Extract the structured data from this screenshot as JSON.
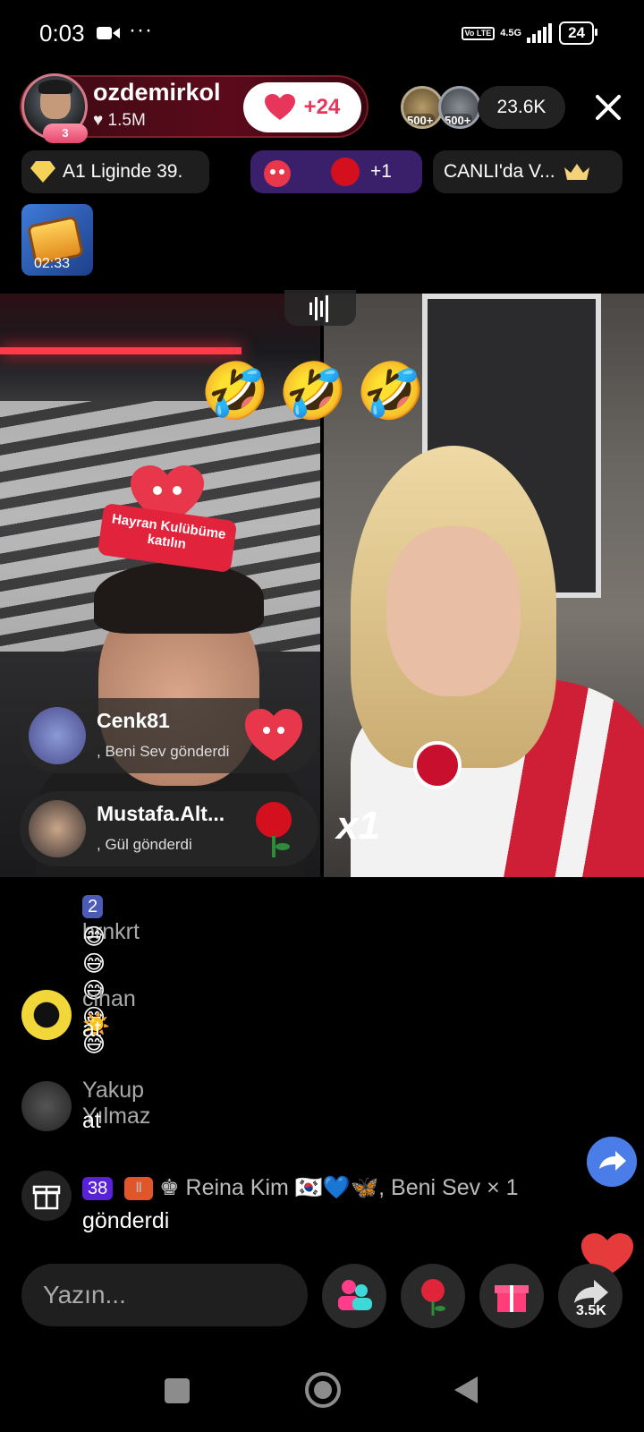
{
  "status_bar": {
    "time": "0:03",
    "dots": "···",
    "network_volte": "Vo LTE",
    "network_type": "4.5G",
    "battery": "24"
  },
  "host": {
    "name": "ozdemirkol",
    "likes": "♥ 1.5M",
    "rank": "3",
    "like_button": "+24"
  },
  "viewers": {
    "badge_1": "500+",
    "badge_2": "500+",
    "count": "23.6K"
  },
  "pills": {
    "league": "A1 Liginde 39.",
    "gift_plus": "+1",
    "canli": "CANLI'da V..."
  },
  "event": {
    "timer": "02:33"
  },
  "stream": {
    "emojis": [
      "🤣",
      "🤣",
      "🤣"
    ],
    "fan_club_text": "Hayran Kulübüme katılın",
    "multiplier": "x1"
  },
  "gift_notifications": [
    {
      "name": "Cenk81",
      "sub": ", Beni Sev  gönderdi"
    },
    {
      "name": "Mustafa.Alt...",
      "sub": ", Gül  gönderdi"
    }
  ],
  "chat": [
    {
      "badge": "2",
      "name": "brnkrt",
      "text": "😅😅😅😅😅"
    },
    {
      "name": "cihan☀️",
      "text": "at"
    },
    {
      "name": "Yakup Yılmaz",
      "text": "at"
    }
  ],
  "gift_chat": {
    "gem_badge": "38",
    "line": "♚ Reina Kim 🇰🇷💙🦋, Beni Sev",
    "count": "× 1",
    "line2": "gönderdi"
  },
  "bottom": {
    "input_placeholder": "Yazın...",
    "share_count": "3.5K"
  },
  "colors": {
    "accent": "#e8365a",
    "gift_pill": "#3a1f6a",
    "share_blue": "#4a7de8"
  }
}
